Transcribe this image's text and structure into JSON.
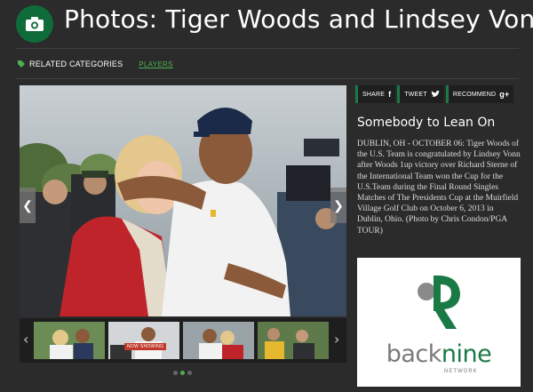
{
  "header": {
    "title": "Photos: Tiger Woods and Lindsey Vonn",
    "icon": "camera-icon",
    "badge_color": "#0f6b3a"
  },
  "categories": {
    "label": "RELATED CATEGORIES",
    "items": [
      "PLAYERS"
    ],
    "accent_color": "#4caf50"
  },
  "gallery": {
    "thumb_badge": "NOW SHOWING",
    "slide_count": 3,
    "active_slide": 2
  },
  "share": {
    "share_label": "SHARE",
    "tweet_label": "TWEET",
    "recommend_label": "RECOMMEND",
    "share_icon": "f",
    "recommend_icon": "g+"
  },
  "caption": {
    "title": "Somebody to Lean On",
    "text": "DUBLIN, OH - OCTOBER 06: Tiger Woods of the U.S. Team is congratulated by Lindsey Vonn after Woods 1up victory over Richard Sterne of the International Team won the Cup for the U.S.Team during the Final Round Singles Matches of The Presidents Cup at the Muirfield Village Golf Club on October 6, 2013 in Dublin, Ohio. (Photo by Chris Condon/PGA TOUR)"
  },
  "ad": {
    "brand_gray": "back",
    "brand_green": "nine",
    "sub": "NETWORK"
  }
}
